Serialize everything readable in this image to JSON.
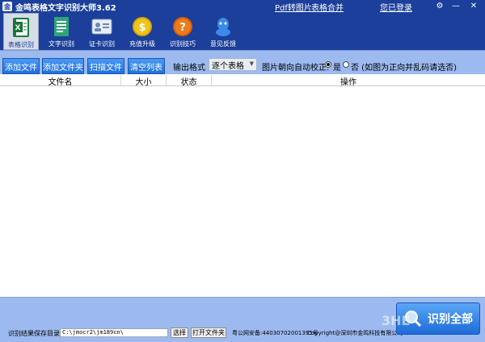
{
  "app": {
    "title": "金鸣表格文字识别大师3.62",
    "top_links": {
      "pdf_to_image": "Pdf转图片",
      "table_merge": "表格合并",
      "login": "您已登录"
    },
    "window_controls": {
      "settings": "⚙",
      "minimize": "—",
      "close": "✕"
    }
  },
  "toolbar": {
    "items": [
      {
        "label": "表格识别",
        "icon": "excel-icon",
        "active": true
      },
      {
        "label": "文字识别",
        "icon": "document-icon",
        "active": false
      },
      {
        "label": "证卡识别",
        "icon": "id-card-icon",
        "active": false
      },
      {
        "label": "充值升级",
        "icon": "coin-icon",
        "active": false
      },
      {
        "label": "识别技巧",
        "icon": "help-icon",
        "active": false
      },
      {
        "label": "意见反馈",
        "icon": "feedback-icon",
        "active": false
      }
    ]
  },
  "actions": {
    "add_file": "添加文件",
    "add_folder": "添加文件夹",
    "scan_file": "扫描文件",
    "clear_list": "清空列表",
    "output_format_label": "输出格式",
    "output_format_value": "逐个表格",
    "orientation_label": "图片朝向自动校正:",
    "orientation_yes": "是",
    "orientation_no": "否 (如图为正向并乱码请选否)",
    "orientation_selected": "yes"
  },
  "table": {
    "columns": [
      "文件名",
      "大小",
      "状态",
      "操作"
    ],
    "rows": []
  },
  "bottom": {
    "save_dir_label": "识别结果保存目录:",
    "save_dir_value": "C:\\jmocr2\\jm189cn\\",
    "choose_button": "选择",
    "open_folder_button": "打开文件夹",
    "icp": "粤公网安备:44030702001395号",
    "copyright": "Copyright@深圳市金鸣科技有限公司",
    "recognize_all": "识别全部"
  },
  "watermark": "3HE",
  "colors": {
    "title_bar": "#1b3f9a",
    "action_bar": "#9dbaf0",
    "button": "#1f70db"
  }
}
